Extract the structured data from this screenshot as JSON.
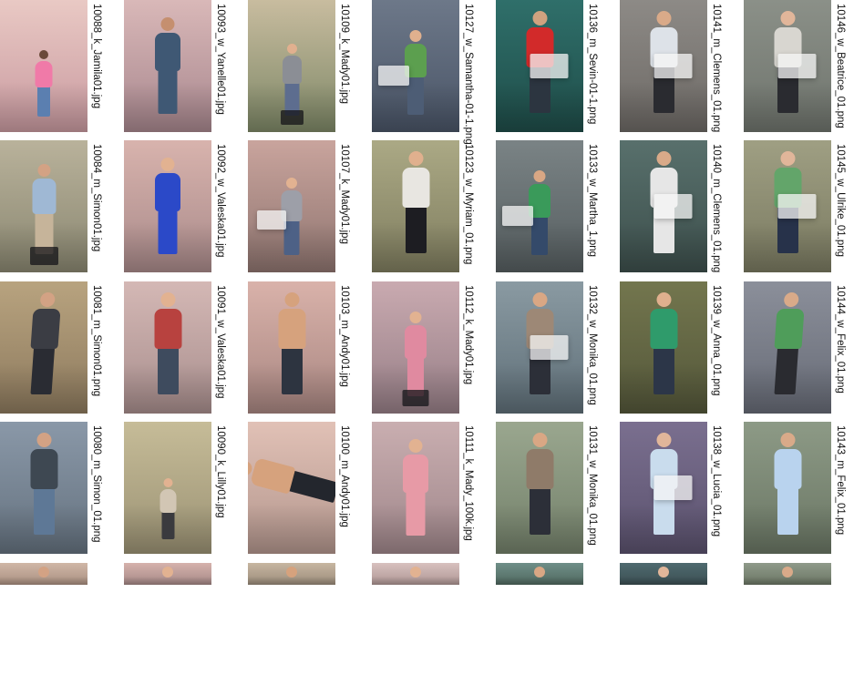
{
  "rows": [
    [
      {
        "file": "10088_k_Jamila01.jpg",
        "bg": [
          "#e9c9c4",
          "#c99aa0"
        ],
        "skin": "#6b4a3a",
        "top": "#f07aa8",
        "bottom": "#5b7fb0",
        "pose": "stand",
        "scale": 0.55
      },
      {
        "file": "10093_w_Yanelle01.jpg",
        "bg": [
          "#d9b8b8",
          "#a8878e"
        ],
        "skin": "#c58f6f",
        "top": "#3f5874",
        "bottom": "#3f5874",
        "pose": "stand",
        "scale": 0.8
      },
      {
        "file": "10109_k_Mady01.jpg",
        "bg": [
          "#c8bc9f",
          "#7e8867"
        ],
        "skin": "#e1b08f",
        "top": "#8b8e95",
        "bottom": "#5d6d8f",
        "pose": "sit",
        "scale": 0.6
      },
      {
        "file": "10127_w_Samantha-01-1.png",
        "bg": [
          "#6d7889",
          "#4a5567"
        ],
        "skin": "#e0b08e",
        "top": "#5c9f4f",
        "bottom": "#4d5d75",
        "pose": "desk",
        "scale": 0.7
      },
      {
        "file": "10136_m_Sevin-01-1.png",
        "bg": [
          "#2f6f6a",
          "#1f4d49"
        ],
        "skin": "#d0a27f",
        "top": "#d22a2a",
        "bottom": "#2c3540",
        "pose": "counter",
        "scale": 0.85
      },
      {
        "file": "10141_m_Clemens_01.png",
        "bg": [
          "#8d8a86",
          "#6d6965"
        ],
        "skin": "#d9aa89",
        "top": "#dde2e8",
        "bottom": "#2a2b30",
        "pose": "counter",
        "scale": 0.85
      },
      {
        "file": "10146_w_Beatrice_01.png",
        "bg": [
          "#8b9088",
          "#6f746d"
        ],
        "skin": "#e1b69a",
        "top": "#d8d6d0",
        "bottom": "#2a2b30",
        "pose": "counter",
        "scale": 0.85
      }
    ],
    [
      {
        "file": "10084_m_Simon01.jpg",
        "bg": [
          "#b9b29b",
          "#8a8771"
        ],
        "skin": "#d3a284",
        "top": "#9fb8d4",
        "bottom": "#c6b49a",
        "pose": "sit",
        "scale": 0.75
      },
      {
        "file": "10092_w_Valeska01.jpg",
        "bg": [
          "#d8b3ad",
          "#a98a8a"
        ],
        "skin": "#e2b291",
        "top": "#2b49c8",
        "bottom": "#2b49c8",
        "pose": "stand",
        "scale": 0.8
      },
      {
        "file": "10107_k_Mady01.jpg",
        "bg": [
          "#c9a49d",
          "#8f7570"
        ],
        "skin": "#e2b291",
        "top": "#9d9fa8",
        "bottom": "#4d6186",
        "pose": "desk",
        "scale": 0.65
      },
      {
        "file": "10123_w_Myriam_01.png",
        "bg": [
          "#aba985",
          "#7f7d5f"
        ],
        "skin": "#e0b08e",
        "top": "#e8e6e1",
        "bottom": "#1d1d22",
        "pose": "stand",
        "scale": 0.85
      },
      {
        "file": "10133_w_Martha_1.png",
        "bg": [
          "#7a8385",
          "#565e60"
        ],
        "skin": "#d9a784",
        "top": "#3a9a5a",
        "bottom": "#344a6a",
        "pose": "desk",
        "scale": 0.7
      },
      {
        "file": "10140_m_Clemens_01.png",
        "bg": [
          "#58706c",
          "#3d4f4c"
        ],
        "skin": "#d9aa89",
        "top": "#e6e6e6",
        "bottom": "#e6e6e6",
        "pose": "counter",
        "scale": 0.85
      },
      {
        "file": "10145_w_Ulrike_01.png",
        "bg": [
          "#9f9f83",
          "#7a7a61"
        ],
        "skin": "#e1b69a",
        "top": "#63a56a",
        "bottom": "#27324a",
        "pose": "counter",
        "scale": 0.85
      }
    ],
    [
      {
        "file": "10081_m_Simon01.png",
        "bg": [
          "#b8a37f",
          "#8d7a5e"
        ],
        "skin": "#d3a284",
        "top": "#3b3d44",
        "bottom": "#2a2c33",
        "pose": "walk",
        "scale": 0.85
      },
      {
        "file": "10091_w_Valeska01.jpg",
        "bg": [
          "#d4b8b5",
          "#a88e8d"
        ],
        "skin": "#e2b291",
        "top": "#b8423f",
        "bottom": "#3e4b5e",
        "pose": "stand",
        "scale": 0.85
      },
      {
        "file": "10103_m_Andy01.jpg",
        "bg": [
          "#d9b2aa",
          "#a88681"
        ],
        "skin": "#d6a27d",
        "top": "#d6a27d",
        "bottom": "#2d3440",
        "pose": "stand",
        "scale": 0.85
      },
      {
        "file": "10112_k_Mady01.jpg",
        "bg": [
          "#c9aab0",
          "#967e86"
        ],
        "skin": "#e2b291",
        "top": "#e08aa0",
        "bottom": "#e08aa0",
        "pose": "sit",
        "scale": 0.7
      },
      {
        "file": "10132_w_Monika_01.png",
        "bg": [
          "#8a9aa2",
          "#5f6f78"
        ],
        "skin": "#d9a784",
        "top": "#9d8876",
        "bottom": "#2c2f38",
        "pose": "counter",
        "scale": 0.85
      },
      {
        "file": "10139_w_Anna_01.png",
        "bg": [
          "#73764e",
          "#54573a"
        ],
        "skin": "#e0b08e",
        "top": "#2f9b6b",
        "bottom": "#2c3648",
        "pose": "stand",
        "scale": 0.85
      },
      {
        "file": "10144_w_Felix_01.png",
        "bg": [
          "#8b8f9a",
          "#676b76"
        ],
        "skin": "#d9aa89",
        "top": "#4f9d5a",
        "bottom": "#2a2b30",
        "pose": "walk",
        "scale": 0.85
      }
    ],
    [
      {
        "file": "10080_m_Simon_01.png",
        "bg": [
          "#8a98a8",
          "#65727f"
        ],
        "skin": "#d3a284",
        "top": "#3e4852",
        "bottom": "#5e7896",
        "pose": "stand",
        "scale": 0.85
      },
      {
        "file": "10090_k_Lilly01.jpg",
        "bg": [
          "#c6bc98",
          "#9b9274"
        ],
        "skin": "#e2b291",
        "top": "#d2c6b4",
        "bottom": "#3a3a3e",
        "pose": "stand",
        "scale": 0.5
      },
      {
        "file": "10100_m_Andy01.jpg",
        "bg": [
          "#e1c1b6",
          "#b3968d"
        ],
        "skin": "#d6a27d",
        "top": "#d6a27d",
        "bottom": "#23262d",
        "pose": "lie",
        "scale": 0.85
      },
      {
        "file": "10111_k_Mady_100k.jpg",
        "bg": [
          "#c9aeb0",
          "#9f868a"
        ],
        "skin": "#e2b291",
        "top": "#e79aa6",
        "bottom": "#e79aa6",
        "pose": "stand",
        "scale": 0.8
      },
      {
        "file": "10131_w_Monika_01.png",
        "bg": [
          "#9aa78f",
          "#73806a"
        ],
        "skin": "#d9a784",
        "top": "#8f7b69",
        "bottom": "#2c2f38",
        "pose": "stand",
        "scale": 0.85
      },
      {
        "file": "10138_w_Lucia_01.png",
        "bg": [
          "#7a6f8f",
          "#5b526e"
        ],
        "skin": "#e1b69a",
        "top": "#c9dced",
        "bottom": "#c9dced",
        "pose": "counter",
        "scale": 0.85
      },
      {
        "file": "10143_m_Felix_01.png",
        "bg": [
          "#8d9a86",
          "#6a7664"
        ],
        "skin": "#d9aa89",
        "top": "#b9d3ee",
        "bottom": "#b9d3ee",
        "pose": "stand",
        "scale": 0.85
      }
    ],
    [
      {
        "file": "",
        "bg": [
          "#d0b7a7",
          "#a98f80"
        ],
        "skin": "#d3a284",
        "top": "#8d8f97",
        "bottom": "#2a2c33",
        "pose": "stand",
        "scale": 0.85
      },
      {
        "file": "",
        "bg": [
          "#d6b2ac",
          "#a48886"
        ],
        "skin": "#e2b291",
        "top": "#a35a5d",
        "bottom": "#3e4b5e",
        "pose": "stand",
        "scale": 0.85
      },
      {
        "file": "",
        "bg": [
          "#c7b6a1",
          "#9a8b7a"
        ],
        "skin": "#d6a27d",
        "top": "#6f7a86",
        "bottom": "#2d3440",
        "pose": "stand",
        "scale": 0.85
      },
      {
        "file": "",
        "bg": [
          "#d8c1bf",
          "#ad9593"
        ],
        "skin": "#e2b291",
        "top": "#cbd3dd",
        "bottom": "#2d3440",
        "pose": "stand",
        "scale": 0.85
      },
      {
        "file": "",
        "bg": [
          "#6f8f88",
          "#50685f"
        ],
        "skin": "#d9a784",
        "top": "#394a57",
        "bottom": "#2c2f38",
        "pose": "stand",
        "scale": 0.85
      },
      {
        "file": "",
        "bg": [
          "#4f6a6f",
          "#3b4f53"
        ],
        "skin": "#e1b69a",
        "top": "#2f6d4c",
        "bottom": "#2c3648",
        "pose": "stand",
        "scale": 0.85
      },
      {
        "file": "",
        "bg": [
          "#8f9a8a",
          "#6b7664"
        ],
        "skin": "#d9aa89",
        "top": "#b7b2a6",
        "bottom": "#2a2b30",
        "pose": "stand",
        "scale": 0.85
      }
    ]
  ]
}
